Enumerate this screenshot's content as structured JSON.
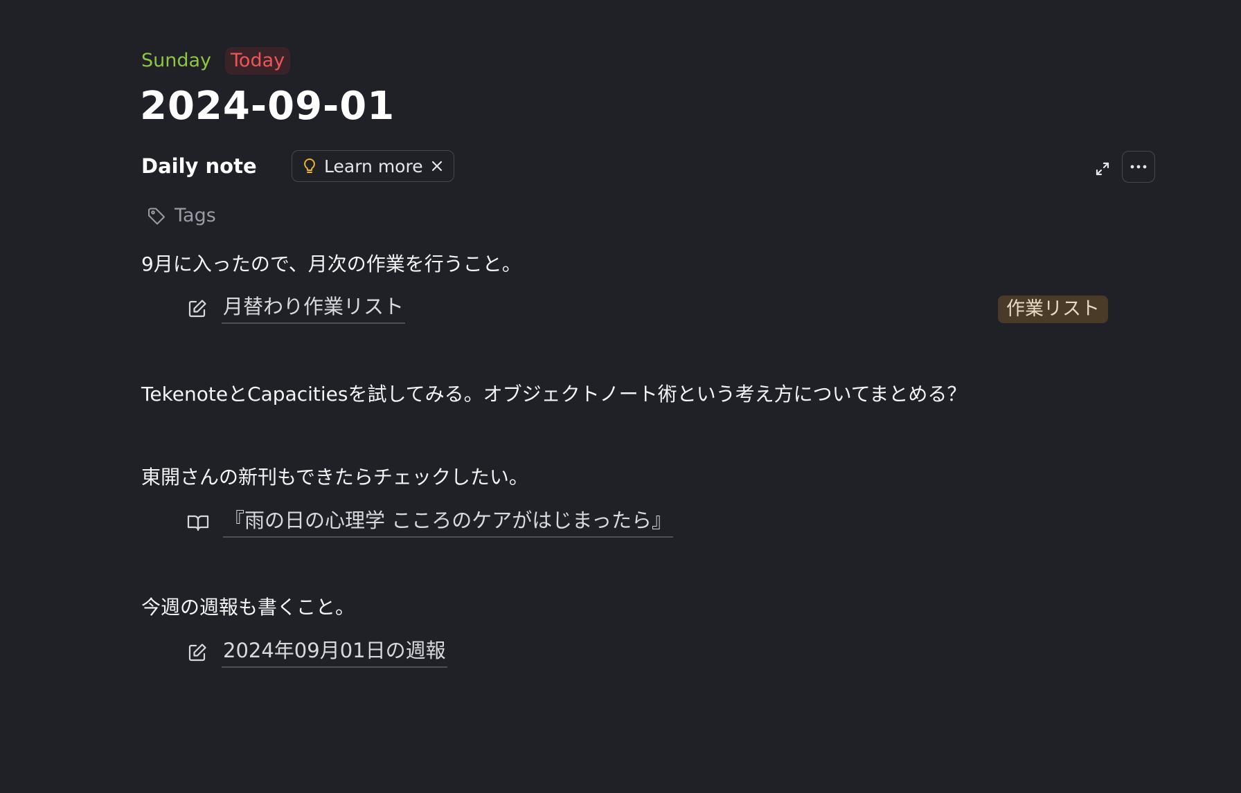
{
  "header": {
    "weekday": "Sunday",
    "today_badge": "Today",
    "date_title": "2024-09-01"
  },
  "object_type": {
    "label": "Daily note",
    "learn_more_label": "Learn more"
  },
  "tags": {
    "label": "Tags"
  },
  "content": {
    "para1": "9月に入ったので、月次の作業を行うこと。",
    "link1": "月替わり作業リスト",
    "link1_tag": "作業リスト",
    "para2": "TekenoteとCapacitiesを試してみる。オブジェクトノート術という考え方についてまとめる？",
    "para3": "東開さんの新刊もできたらチェックしたい。",
    "link2": "『雨の日の心理学 こころのケアがはじまったら』",
    "para4": "今週の週報も書くこと。",
    "link3": "2024年09月01日の週報"
  },
  "colors": {
    "background": "#1f2127",
    "weekday": "#8ec63f",
    "today": "#ee5656",
    "today_bg": "#3a2328",
    "tag_chip_bg": "#4a3a28",
    "bulb": "#f0b429"
  },
  "icons": {
    "learn_more": "lightbulb-icon",
    "dismiss": "close-icon",
    "expand": "expand-icon",
    "more": "more-horizontal-icon",
    "tags": "tag-icon",
    "note_link": "edit-icon",
    "book_link": "book-open-icon"
  }
}
